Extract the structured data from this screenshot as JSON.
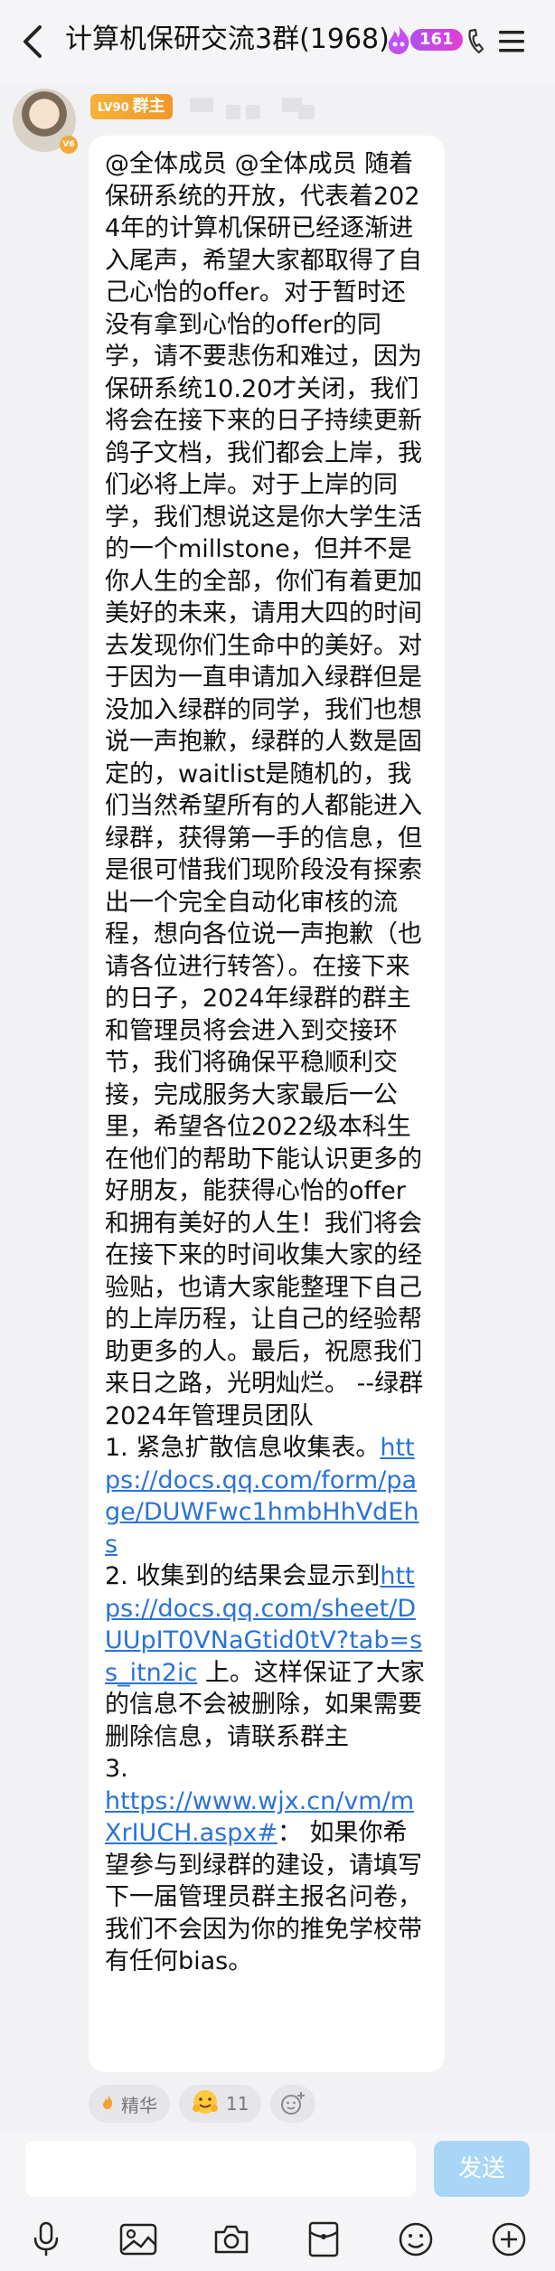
{
  "header": {
    "title": "计算机保研交流3群(1968)",
    "badge_count": "161"
  },
  "sender": {
    "level_num": "LV90",
    "level_title": "群主",
    "avatar_level": "V6"
  },
  "message": {
    "segments": [
      {
        "type": "text",
        "content": "@全体成员 @全体成员 随着保研系统的开放，代表着2024年的计算机保研已经逐渐进入尾声，希望大家都取得了自己心怡的offer。对于暂时还没有拿到心怡的offer的同学，请不要悲伤和难过，因为保研系统10.20才关闭，我们将会在接下来的日子持续更新鸽子文档，我们都会上岸，我们必将上岸。对于上岸的同学，我们想说这是你大学生活的一个millstone，但并不是你人生的全部，你们有着更加美好的未来，请用大四的时间去发现你们生命中的美好。对于因为一直申请加入绿群但是没加入绿群的同学，我们也想说一声抱歉，绿群的人数是固定的，waitlist是随机的，我们当然希望所有的人都能进入绿群，获得第一手的信息，但是很可惜我们现阶段没有探索出一个完全自动化审核的流程，想向各位说一声抱歉（也请各位进行转答）。在接下来的日子，2024年绿群的群主和管理员将会进入到交接环节，我们将确保平稳顺利交接，完成服务大家最后一公里，希望各位2022级本科生在他们的帮助下能认识更多的好朋友，能获得心怡的offer和拥有美好的人生！我们将会在接下来的时间收集大家的经验贴，也请大家能整理下自己的上岸历程，让自己的经验帮助更多的人。最后，祝愿我们来日之路，光明灿烂。 --绿群2024年管理员团队"
      },
      {
        "type": "break"
      },
      {
        "type": "text",
        "content": "1. 紧急扩散信息收集表。"
      },
      {
        "type": "link",
        "content": "https://docs.qq.com/form/page/DUWFwc1hmbHhVdEhs"
      },
      {
        "type": "break"
      },
      {
        "type": "text",
        "content": "2. 收集到的结果会显示到"
      },
      {
        "type": "link",
        "content": "https://docs.qq.com/sheet/DUUpIT0VNaGtid0tV?tab=ss_itn2ic"
      },
      {
        "type": "text",
        "content": " 上。这样保证了大家的信息不会被删除，如果需要删除信息，请联系群主"
      },
      {
        "type": "break"
      },
      {
        "type": "text",
        "content": "3."
      },
      {
        "type": "break"
      },
      {
        "type": "link",
        "content": "https://www.wjx.cn/vm/mXrIUCH.aspx#"
      },
      {
        "type": "text",
        "content": "： 如果你希望参与到绿群的建设，请填写下一届管理员群主报名问卷，我们不会因为你的推免学校带有任何bias。"
      }
    ]
  },
  "reactions": {
    "essence_label": "精华",
    "emoji_count": "11"
  },
  "input": {
    "send_label": "发送"
  },
  "icons": {
    "back": "chevron-left-icon",
    "flame": "flame-badge-icon",
    "call": "phone-icon",
    "menu": "menu-icon",
    "essence": "flame-small-icon",
    "emoji_reaction": "hugging-face-icon",
    "add_reaction": "add-emoji-icon",
    "toolbar": [
      "microphone-icon",
      "image-icon",
      "camera-icon",
      "red-packet-icon",
      "emoji-icon",
      "plus-icon"
    ]
  },
  "colors": {
    "link": "#2b73d6",
    "send_button": "#a9d6f7",
    "badge_gradient_start": "#b04ef2",
    "level_tag": "#f7b23b"
  }
}
